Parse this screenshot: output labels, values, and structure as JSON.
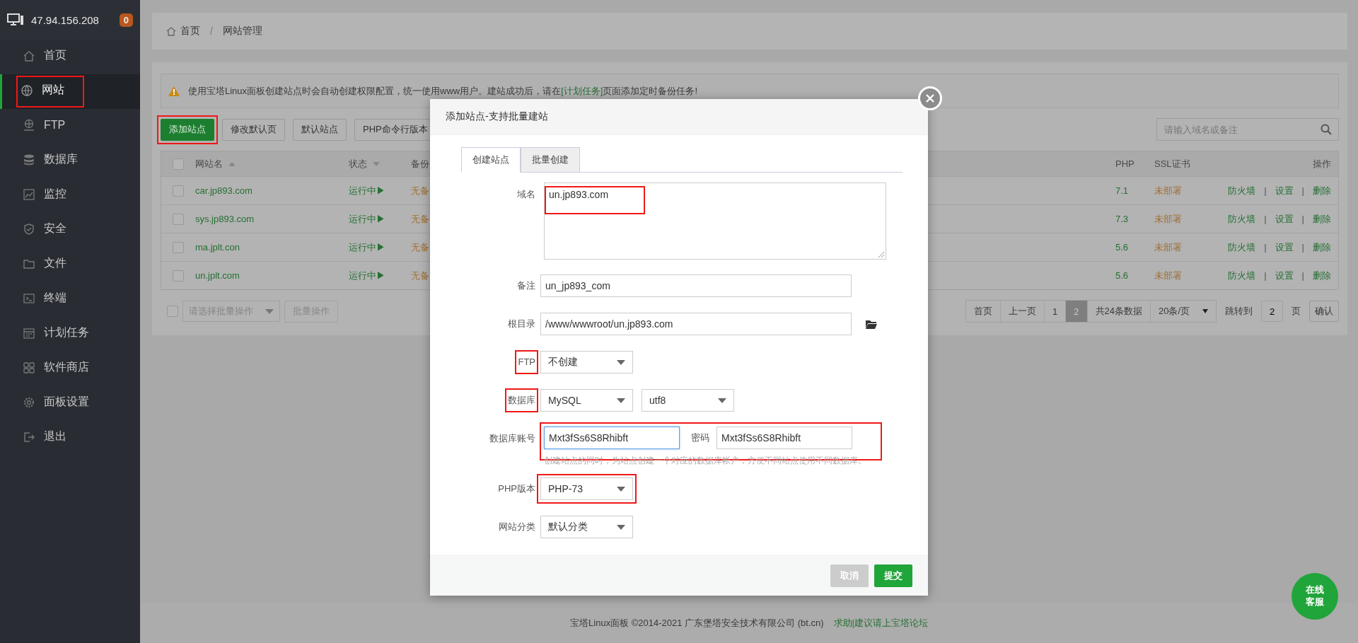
{
  "sidebar": {
    "host": "47.94.156.208",
    "badge": "0",
    "items": [
      {
        "label": "首页",
        "selected": false,
        "annotated": false
      },
      {
        "label": "网站",
        "selected": true,
        "annotated": true
      },
      {
        "label": "FTP",
        "selected": false,
        "annotated": false
      },
      {
        "label": "数据库",
        "selected": false,
        "annotated": false
      },
      {
        "label": "监控",
        "selected": false,
        "annotated": false
      },
      {
        "label": "安全",
        "selected": false,
        "annotated": false
      },
      {
        "label": "文件",
        "selected": false,
        "annotated": false
      },
      {
        "label": "终端",
        "selected": false,
        "annotated": false
      },
      {
        "label": "计划任务",
        "selected": false,
        "annotated": false
      },
      {
        "label": "软件商店",
        "selected": false,
        "annotated": false
      },
      {
        "label": "面板设置",
        "selected": false,
        "annotated": false
      },
      {
        "label": "退出",
        "selected": false,
        "annotated": false
      }
    ]
  },
  "breadcrumb": [
    "首页",
    "/",
    "网站管理"
  ],
  "notice": {
    "before": "使用宝塔Linux面板创建站点时会自动创建权限配置，统一使用www用户。建站成功后，请在",
    "link": "[计划任务]",
    "after": "页面添加定时备份任务!"
  },
  "toolbar": {
    "buttons": [
      {
        "label": "添加站点",
        "kind": "primary",
        "annotated": true
      },
      {
        "label": "修改默认页",
        "kind": "default",
        "annotated": false
      },
      {
        "label": "默认站点",
        "kind": "default",
        "annotated": false
      },
      {
        "label": "PHP命令行版本",
        "kind": "default",
        "annotated": false
      }
    ],
    "search": {
      "placeholder": "请输入域名或备注"
    }
  },
  "table": {
    "select_all": false,
    "columns": [
      {
        "label": "网站名",
        "sorted": true,
        "filter": false
      },
      {
        "label": "状态",
        "sorted": false,
        "filter": true
      },
      {
        "label": "备份",
        "sorted": false,
        "filter": false
      },
      {
        "label": "PHP",
        "sorted": false,
        "filter": false
      },
      {
        "label": "SSL证书",
        "sorted": false,
        "filter": false
      },
      {
        "label": "操作",
        "sorted": false,
        "filter": false
      }
    ],
    "rows": [
      {
        "checked": false,
        "name": "car.jp893.com",
        "status": "运行中▶",
        "backup": "无备",
        "php": "7.1",
        "ssl": "未部署",
        "actions": [
          "防火墙",
          "|",
          "设置",
          "|",
          "删除"
        ]
      },
      {
        "checked": false,
        "name": "sys.jp893.com",
        "status": "运行中▶",
        "backup": "无备",
        "php": "7.3",
        "ssl": "未部署",
        "actions": [
          "防火墙",
          "|",
          "设置",
          "|",
          "删除"
        ]
      },
      {
        "checked": false,
        "name": "ma.jplt.con",
        "status": "运行中▶",
        "backup": "无备",
        "php": "5.6",
        "ssl": "未部署",
        "actions": [
          "防火墙",
          "|",
          "设置",
          "|",
          "删除"
        ]
      },
      {
        "checked": false,
        "name": "un.jplt.com",
        "status": "运行中▶",
        "backup": "无备",
        "php": "5.6",
        "ssl": "未部署",
        "actions": [
          "防火墙",
          "|",
          "设置",
          "|",
          "删除"
        ]
      }
    ]
  },
  "batch": {
    "checked": false,
    "placeholder": "请选择批量操作",
    "button": "批量操作"
  },
  "pagination": {
    "pages": [
      {
        "label": "首页",
        "selected": false
      },
      {
        "label": "上一页",
        "selected": false
      },
      {
        "label": "1",
        "selected": false
      },
      {
        "label": "2",
        "selected": true
      }
    ],
    "total": "共24条数据",
    "per_page": "20条/页",
    "jump_label": "跳转到",
    "jump_value": "2",
    "page_unit": "页",
    "confirm": "确认"
  },
  "dialog": {
    "title": "添加站点-支持批量建站",
    "tabs": [
      {
        "label": "创建站点",
        "selected": true
      },
      {
        "label": "批量创建",
        "selected": false
      }
    ],
    "fields": [
      {
        "kind": "textarea",
        "label": "域名",
        "value": "un.jp893.com",
        "label_annotated": false,
        "value_annotated": true
      },
      {
        "kind": "input",
        "label": "备注",
        "value": "un_jp893_com",
        "label_annotated": false,
        "value_annotated": false
      },
      {
        "kind": "path",
        "label": "根目录",
        "value": "/www/wwwroot/un.jp893.com",
        "label_annotated": false,
        "value_annotated": false
      },
      {
        "kind": "select",
        "label": "FTP",
        "values": [
          "不创建"
        ],
        "label_annotated": true,
        "value_annotated": false
      },
      {
        "kind": "select",
        "label": "数据库",
        "values": [
          "MySQL",
          "utf8"
        ],
        "label_annotated": true,
        "value_annotated": false
      },
      {
        "kind": "credentials",
        "label": "数据库账号",
        "value": "Mxt3fSs6S8Rhibft",
        "focused": true,
        "password_label": "密码",
        "password": "Mxt3fSs6S8Rhibft",
        "hint": "创建站点的同时，为站点创建一个对应的数据库帐户，方便不同站点使用不同数据库。",
        "label_annotated": false,
        "value_annotated": true
      },
      {
        "kind": "select",
        "label": "PHP版本",
        "values": [
          "PHP-73"
        ],
        "label_annotated": false,
        "value_annotated": true
      },
      {
        "kind": "select",
        "label": "网站分类",
        "values": [
          "默认分类"
        ],
        "label_annotated": false,
        "value_annotated": false
      }
    ],
    "buttons": [
      {
        "label": "取消",
        "kind": "muted"
      },
      {
        "label": "提交",
        "kind": "primary"
      }
    ]
  },
  "footer": {
    "text": "宝塔Linux面板 ©2014-2021 广东堡塔安全技术有限公司 (bt.cn)",
    "link": "求助|建议请上宝塔论坛"
  },
  "chat_button": {
    "label": "在线客服"
  }
}
